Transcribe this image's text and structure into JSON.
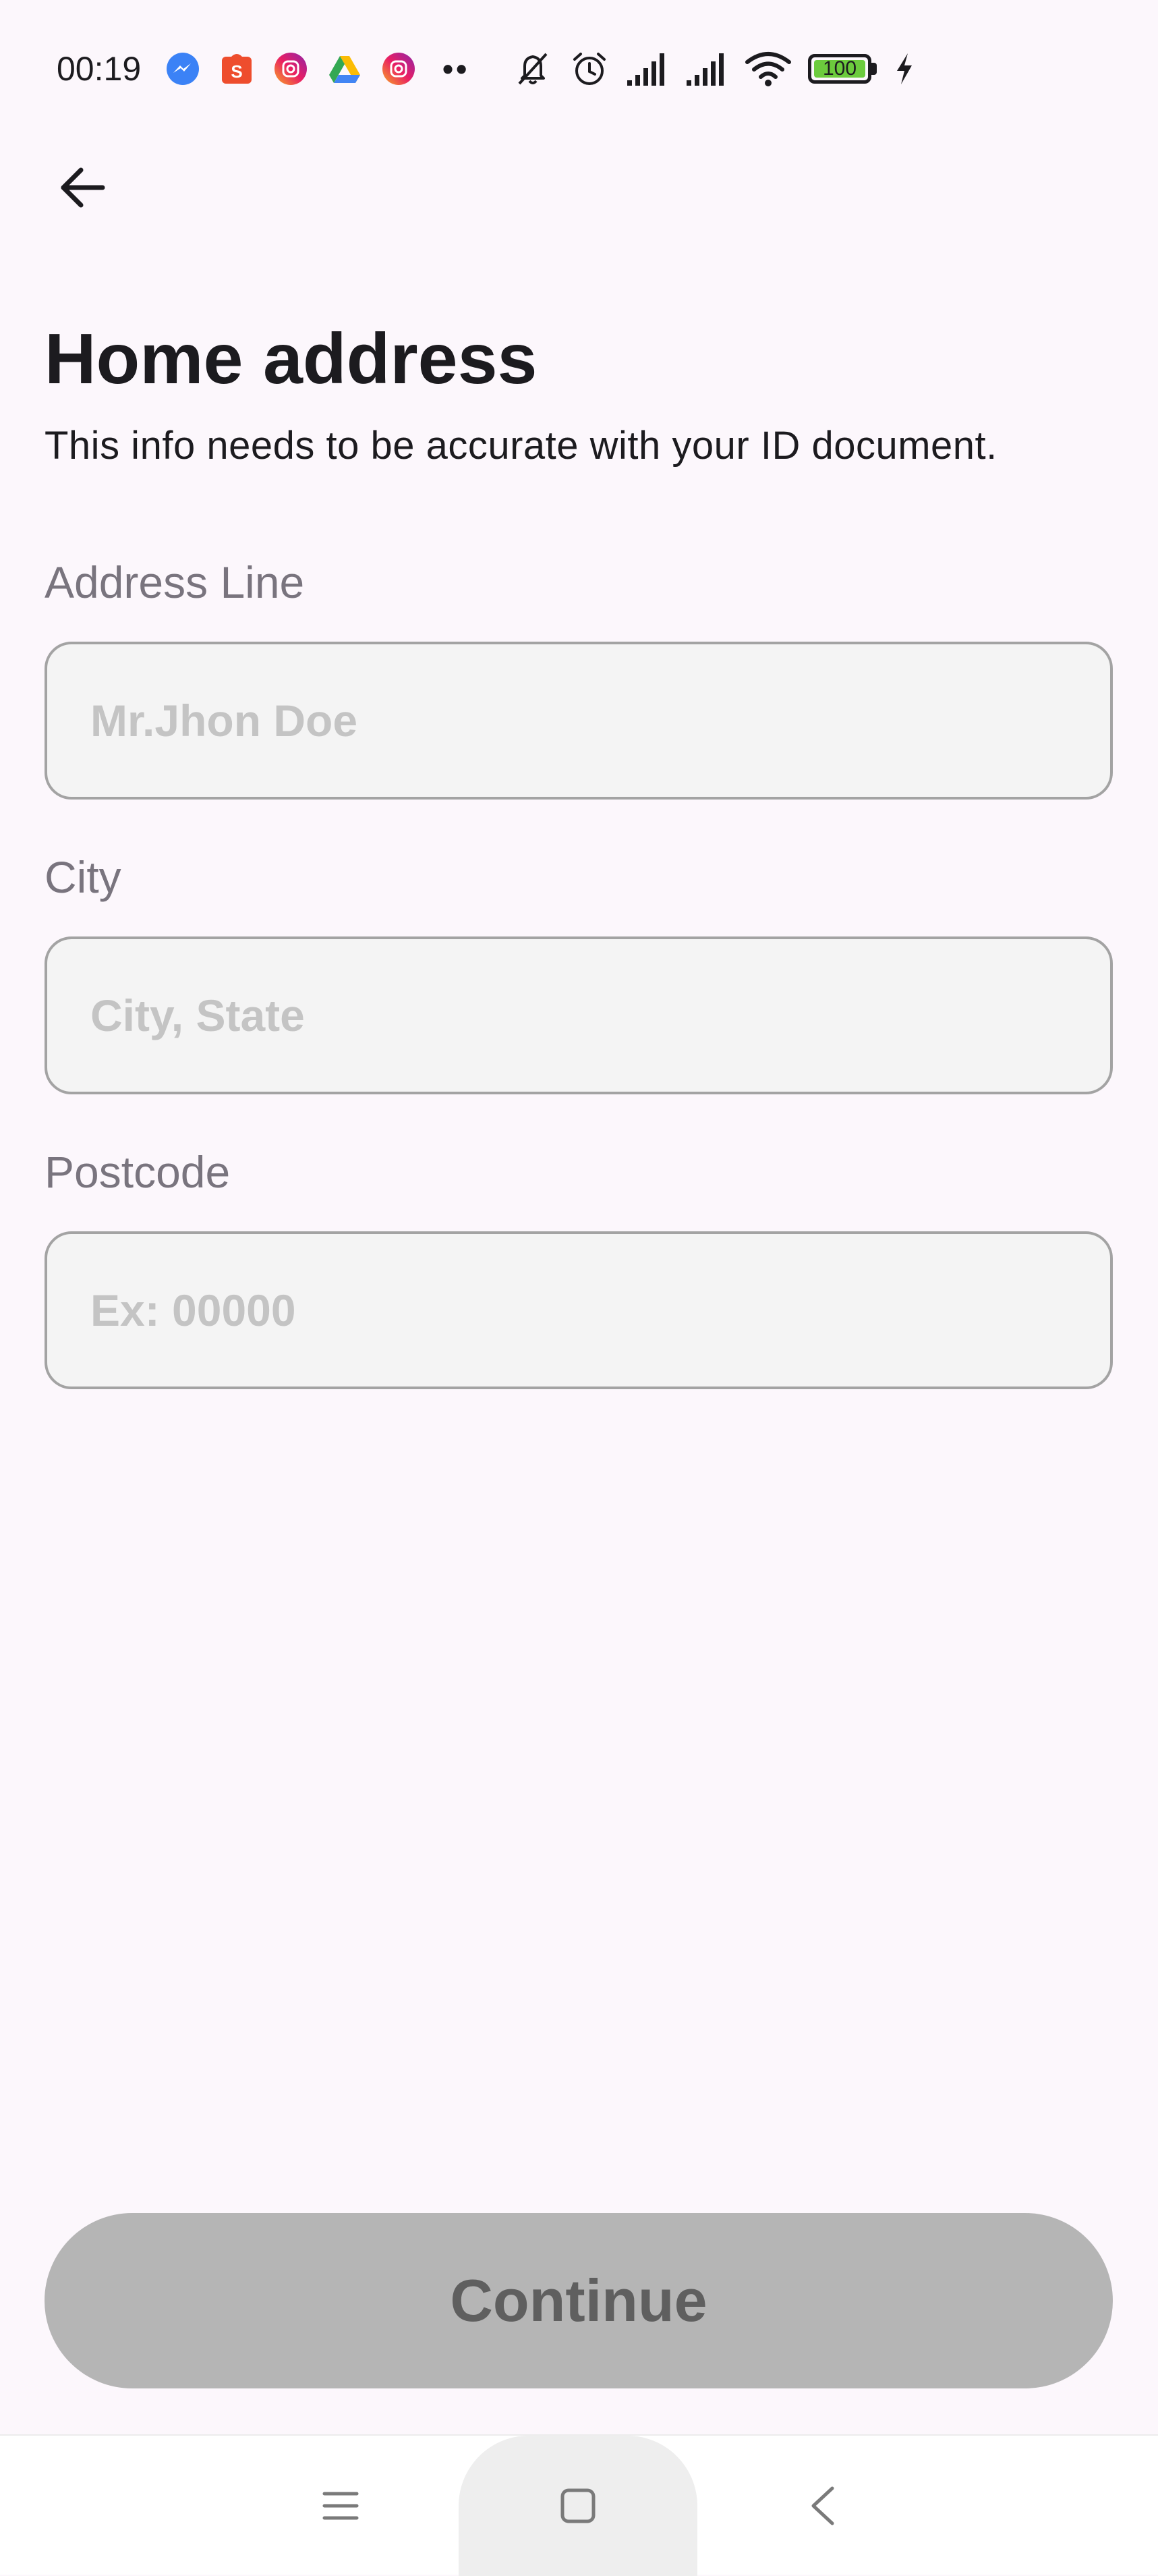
{
  "status_bar": {
    "time": "00:19",
    "app_icons": [
      "messenger-icon",
      "shopee-icon",
      "instagram-icon",
      "google-drive-icon",
      "instagram-icon"
    ],
    "more_indicator": "••",
    "system_icons": [
      "mute-icon",
      "alarm-icon",
      "signal-icon",
      "signal-icon",
      "wifi-icon",
      "battery-icon",
      "charging-icon"
    ],
    "battery_level": "100"
  },
  "app_bar": {
    "back_icon": "arrow-left-icon"
  },
  "page": {
    "title": "Home address",
    "subtitle": "This info needs to be accurate with your ID document."
  },
  "form": {
    "address": {
      "label": "Address Line",
      "value": "",
      "placeholder": "Mr.Jhon Doe"
    },
    "city": {
      "label": "City",
      "value": "",
      "placeholder": "City, State"
    },
    "postcode": {
      "label": "Postcode",
      "value": "",
      "placeholder": "Ex: 00000"
    }
  },
  "actions": {
    "continue_label": "Continue",
    "continue_enabled": false
  },
  "nav_bar": {
    "menu_icon": "menu-icon",
    "home_icon": "home-square-icon",
    "back_icon": "chevron-left-icon"
  },
  "colors": {
    "background": "#fcf7fc",
    "text_primary": "#1c1b1f",
    "label": "#79747e",
    "input_border": "#a3a3a3",
    "input_fill": "#f4f4f4",
    "placeholder": "#c4c4c4",
    "button_disabled_bg": "#b5b5b5",
    "button_disabled_text": "#5f5f5f",
    "battery_green": "#6ccb3d"
  }
}
